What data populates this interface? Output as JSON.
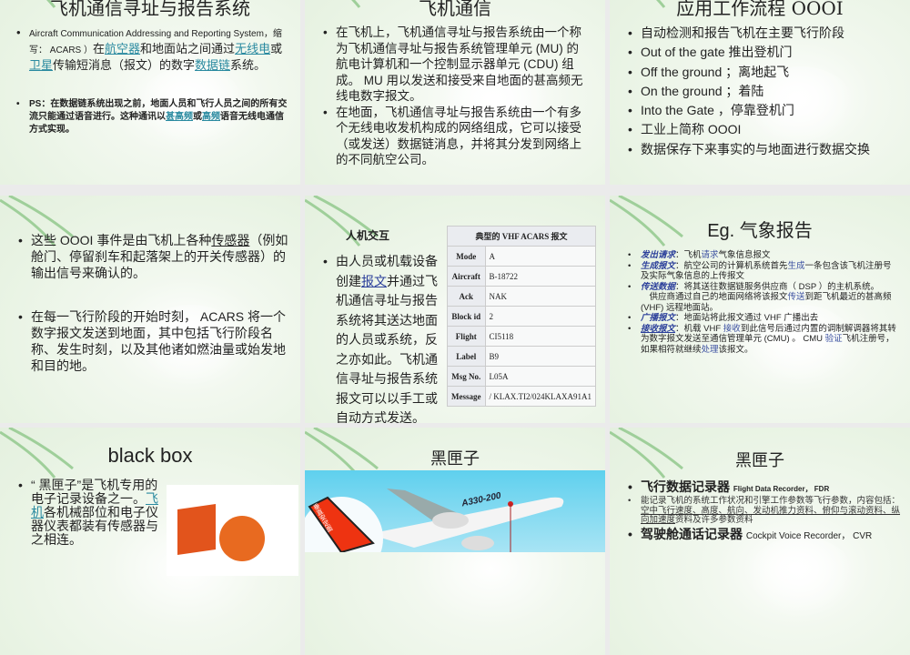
{
  "slides": [
    {
      "title": "飞机通信寻址与报告系统",
      "b1_en": "Aircraft Communication Addressing and Reporting System，缩写： ACARS ）",
      "b1_a": "在",
      "b1_l1": "航空器",
      "b1_b": "和地面站之间通过",
      "b1_l2": "无线电",
      "b1_c": "或",
      "b1_l3": "卫星",
      "b1_d": "传输短消息（报文）的数字",
      "b1_l4": "数据链",
      "b1_e": "系统。",
      "b2_a": "PS：在数据链系统出现之前，地面人员和飞行人员之间的所有交流只能通过语音进行。这种通讯以",
      "b2_l1": "甚高频",
      "b2_b": "或",
      "b2_l2": "高频",
      "b2_c": "语音无线电通信方式实现。"
    },
    {
      "title": "飞机通信",
      "bullets": [
        "在飞机上，飞机通信寻址与报告系统由一个称为飞机通信寻址与报告系统管理单元 (MU) 的航电计算机和一个控制显示器单元 (CDU) 组成。 MU 用以发送和接受来自地面的甚高频无线电数字报文。",
        "在地面，飞机通信寻址与报告系统由一个有多个无线电收发机构成的网络组成，它可以接受（或发送）数据链消息，并将其分发到网络上的不同航空公司。"
      ]
    },
    {
      "title": "应用工作流程 OOOI",
      "bullets": [
        "自动检测和报告飞机在主要飞行阶段",
        "Out of the gate 推出登机门",
        "Off the ground ；离地起飞",
        "On the ground ；着陆",
        "Into the Gate ，停靠登机门",
        "工业上简称 OOOI",
        "数据保存下来事实的与地面进行数据交换"
      ]
    },
    {
      "b1_a": "这些 OOOI 事件是由飞机上各种",
      "b1_l": "传感器",
      "b1_b": "（例如舱门、停留刹车和起落架上的开关传感器）的输出信号来确认的。",
      "b2": "在每一飞行阶段的开始时刻， ACARS 将一个数字报文发送到地面，其中包括飞行阶段名称、发生时刻，以及其他诸如燃油量或始发地和目的地。"
    },
    {
      "heading": "人机交互",
      "b_a": "由人员或机载设备创建",
      "b_l": "报文",
      "b_b": "并通过飞机通信寻址与报告系统将其送达地面的人员或系统，反之亦如此。飞机通信寻址与报告系统报文可以以手工或自动方式发送。",
      "table_title": "典型的 VHF ACARS 报文",
      "rows": [
        {
          "k": "Mode",
          "v": "A"
        },
        {
          "k": "Aircraft",
          "v": "B-18722"
        },
        {
          "k": "Ack",
          "v": "NAK"
        },
        {
          "k": "Block id",
          "v": "2"
        },
        {
          "k": "Flight",
          "v": "CI5118"
        },
        {
          "k": "Label",
          "v": "B9"
        },
        {
          "k": "Msg No.",
          "v": "L05A"
        },
        {
          "k": "Message",
          "v": "/ KLAX.TI2/024KLAXA91A1"
        }
      ]
    },
    {
      "title": "Eg. 气象报告",
      "items": [
        {
          "term": "发出请求",
          "a": "：飞机",
          "h": "请求",
          "b": "气象信息报文"
        },
        {
          "term": "生成报文",
          "a": "：航空公司的计算机系统首先",
          "h": "生成",
          "b": "一条包含该飞机注册号及实际气象信息的上传报文"
        },
        {
          "term": "传送数据",
          "a": "：将其送往数据链服务供应商（ DSP ）的主机系统。",
          "h": "",
          "b": ""
        },
        {
          "term": "广播报文",
          "a": "：地面站将此报文通过 VHF 广播出去",
          "h": "",
          "b": ""
        },
        {
          "term": "接收报文",
          "a": "：机载 VHF ",
          "h": "接收",
          "b": "到此信号后通过内置的调制解调器将其转为数字报文发送至通信管理单元 (CMU) 。 CMU ",
          "h2": "验证",
          "c": "飞机注册号，如果相符就继续",
          "h3": "处理",
          "d": "该报文。"
        }
      ],
      "para_a": "供应商通过自己的地面网络将该报文",
      "para_h": "传送",
      "para_b": "到距飞机最近的甚高频 (VHF) 远程地面站。"
    },
    {
      "title": "black box",
      "b_a": "“ 黑匣子”是飞机专用的电子记录设备之一。",
      "b_l": "飞机",
      "b_b": "各机械部位和电子仪器仪表都装有传感器与之相连。"
    },
    {
      "title": "黑匣子",
      "plane_label": "A330-200",
      "tail_label": "垂直安定面"
    },
    {
      "title": "黑匣子",
      "b1_cn": "飞行数据记录器",
      "b1_en": "Flight Data Recorder， FDR",
      "b2_a": "能记录飞机的系统工作状况和引擎工作参数等飞行参数，内容包括：",
      "b2_u": "空中飞行速度、高度、航向、发动机推力资料、俯仰与滚动资料、纵向加速度",
      "b2_b": "资料及许多参数资料",
      "b3_cn": "驾驶舱通话记录器",
      "b3_en": "Cockpit Voice Recorder， CVR"
    }
  ]
}
